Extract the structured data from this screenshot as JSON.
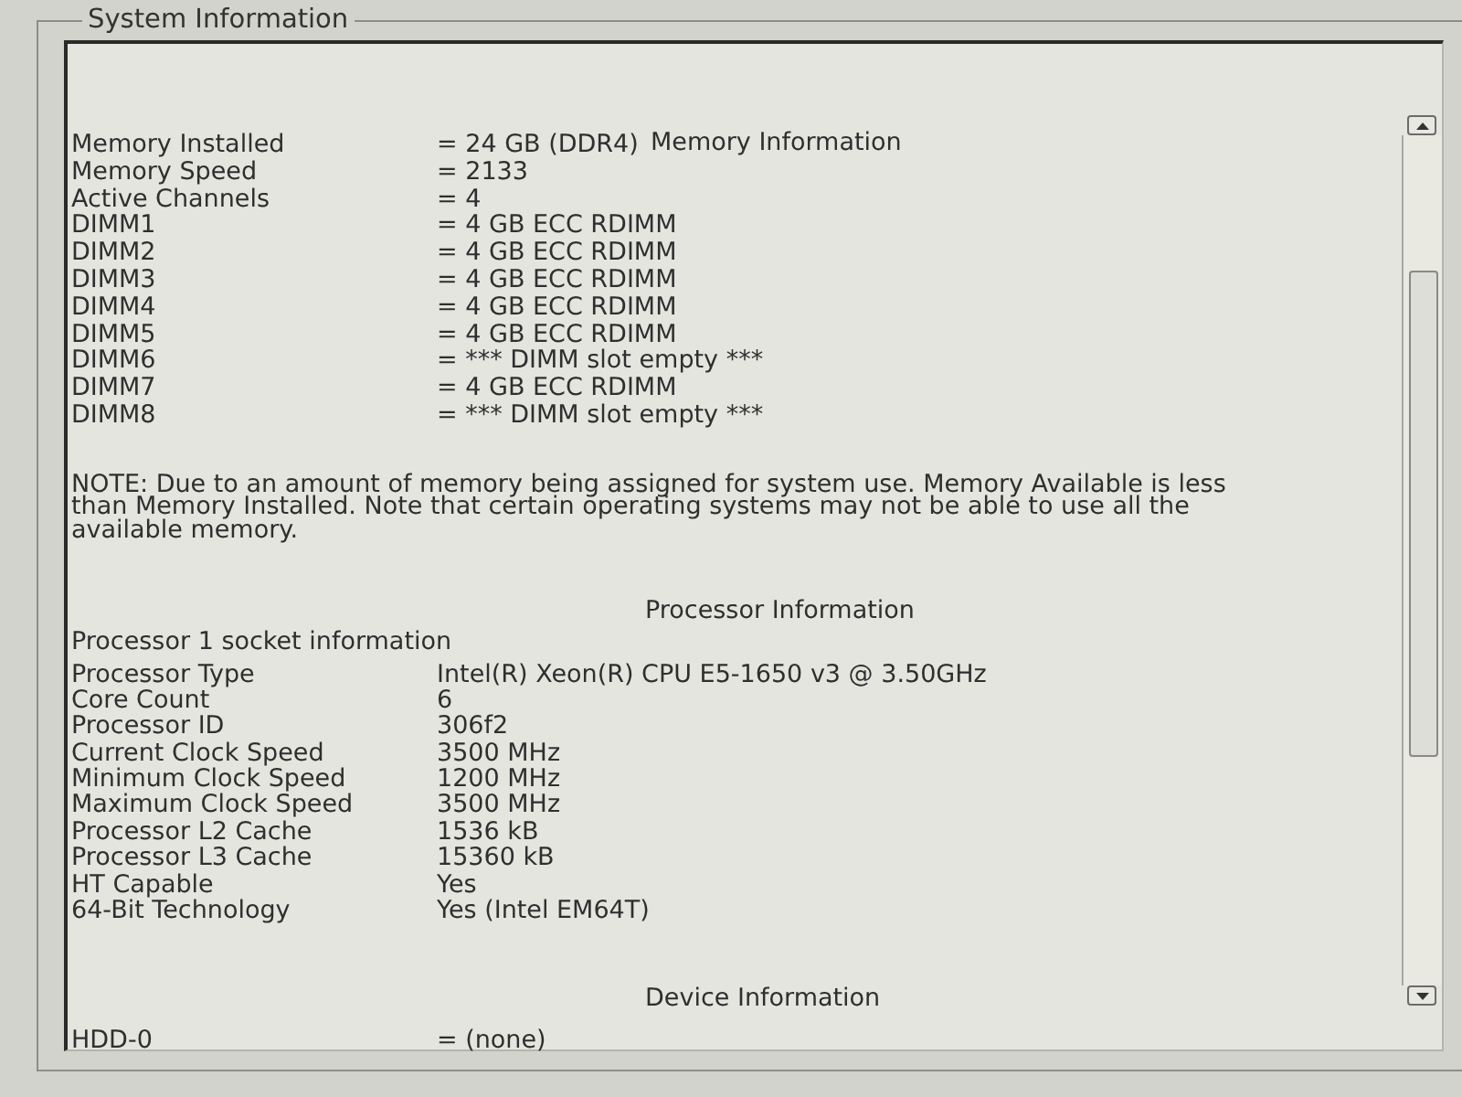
{
  "window": {
    "title": "System Information"
  },
  "sections": [
    {
      "kind": "memory",
      "title": "Memory Information",
      "rows": [
        {
          "label": "Memory Installed",
          "value": "= 24 GB (DDR4)"
        },
        {
          "label": "Memory Speed",
          "value": "= 2133"
        },
        {
          "label": "Active Channels",
          "value": "= 4"
        },
        {
          "label": "DIMM1",
          "value": "= 4 GB ECC RDIMM"
        },
        {
          "label": "DIMM2",
          "value": "= 4 GB ECC RDIMM"
        },
        {
          "label": "DIMM3",
          "value": "= 4 GB ECC RDIMM"
        },
        {
          "label": "DIMM4",
          "value": "= 4 GB ECC RDIMM"
        },
        {
          "label": "DIMM5",
          "value": "= 4 GB ECC RDIMM"
        },
        {
          "label": "DIMM6",
          "value": "= *** DIMM slot empty ***"
        },
        {
          "label": "DIMM7",
          "value": "= 4 GB ECC RDIMM"
        },
        {
          "label": "DIMM8",
          "value": "= *** DIMM slot empty ***"
        }
      ],
      "note": "NOTE: Due to an amount of memory being assigned for system use. Memory Available is less than Memory Installed. Note that certain operating systems may not be able to use all the available memory."
    },
    {
      "kind": "processor",
      "title": "Processor Information",
      "subtitle": "Processor 1 socket information",
      "rows": [
        {
          "label": "Processor Type",
          "value": "Intel(R) Xeon(R) CPU E5-1650 v3 @ 3.50GHz"
        },
        {
          "label": "Core Count",
          "value": "6"
        },
        {
          "label": "Processor ID",
          "value": "306f2"
        },
        {
          "label": "Current Clock Speed",
          "value": "3500 MHz"
        },
        {
          "label": "Minimum Clock Speed",
          "value": "1200 MHz"
        },
        {
          "label": "Maximum Clock Speed",
          "value": "3500 MHz"
        },
        {
          "label": "Processor L2 Cache",
          "value": "1536 kB"
        },
        {
          "label": "Processor L3 Cache",
          "value": "15360 kB"
        },
        {
          "label": "HT Capable",
          "value": "Yes"
        },
        {
          "label": "64-Bit Technology",
          "value": "Yes (Intel EM64T)"
        }
      ]
    },
    {
      "kind": "device",
      "title": "Device Information",
      "rows": [
        {
          "label": "HDD-0",
          "value": "= (none)"
        }
      ]
    }
  ]
}
